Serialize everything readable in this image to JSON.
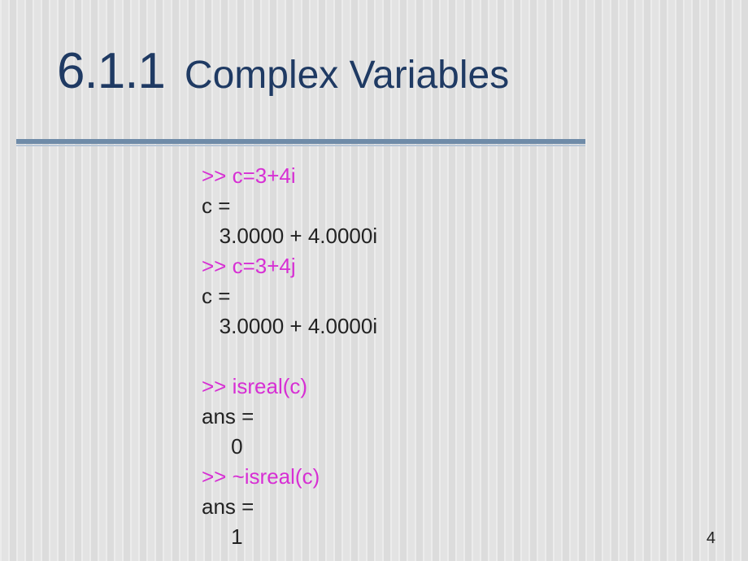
{
  "title": {
    "section_number": "6.1.1",
    "section_text": "Complex Variables"
  },
  "code": {
    "lines": [
      {
        "type": "prompt",
        "text": ">> c=3+4i"
      },
      {
        "type": "out",
        "text": "c ="
      },
      {
        "type": "out",
        "text": "   3.0000 + 4.0000i"
      },
      {
        "type": "prompt",
        "text": ">> c=3+4j"
      },
      {
        "type": "out",
        "text": "c ="
      },
      {
        "type": "out",
        "text": "   3.0000 + 4.0000i"
      },
      {
        "type": "blank",
        "text": ""
      },
      {
        "type": "prompt",
        "text": ">> isreal(c)"
      },
      {
        "type": "out",
        "text": "ans ="
      },
      {
        "type": "out",
        "text": "     0"
      },
      {
        "type": "prompt",
        "text": ">> ~isreal(c)"
      },
      {
        "type": "out",
        "text": "ans ="
      },
      {
        "type": "out",
        "text": "     1"
      }
    ]
  },
  "page_number": "4"
}
